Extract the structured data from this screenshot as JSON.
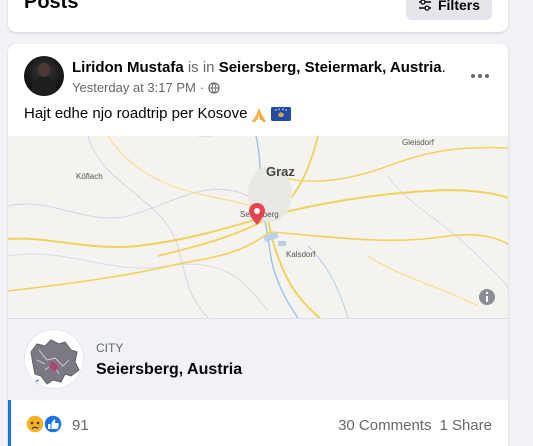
{
  "header": {
    "title": "Posts",
    "filters_label": "Filters"
  },
  "post": {
    "author": "Liridon Mustafa",
    "is_in": "is in",
    "location": "Seiersberg, Steiermark, Austria",
    "period": ".",
    "timestamp": "Yesterday at 3:17 PM",
    "separator": "·",
    "privacy_icon": "globe-icon",
    "text": "Hajt edhe njo roadtrip per Kosove",
    "emojis": [
      "folded-hands-emoji",
      "kosovo-flag-emoji"
    ]
  },
  "map": {
    "labels": {
      "graz": "Graz",
      "seiersberg": "Seiersberg",
      "kalsdorf": "Kalsdorf",
      "koflach": "Köflach",
      "gleisdorf": "Gleisdorf"
    },
    "pin_color": "#e8434f"
  },
  "place": {
    "kind": "CITY",
    "name": "Seiersberg, Austria"
  },
  "engagement": {
    "reaction_icons": [
      "sad-reaction-icon",
      "like-reaction-icon"
    ],
    "reaction_count": "91",
    "comments": "30 Comments",
    "shares": "1 Share"
  },
  "colors": {
    "accent": "#1b74e4",
    "muted_text": "#65676b",
    "road": "#f2d15a"
  }
}
